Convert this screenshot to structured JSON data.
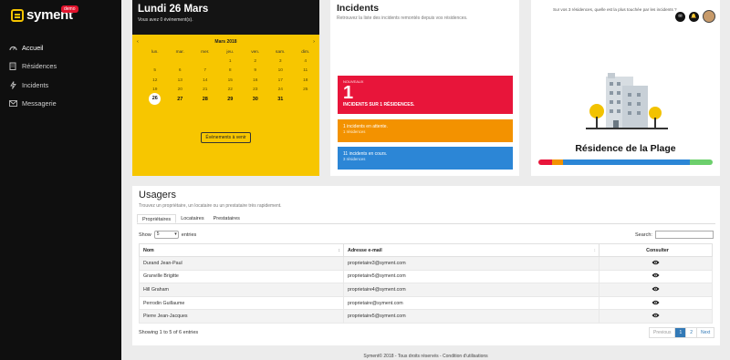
{
  "brand": {
    "name": "syment",
    "badge": "demo"
  },
  "nav": [
    {
      "label": "Accueil",
      "icon": "dashboard-icon"
    },
    {
      "label": "Résidences",
      "icon": "building-icon"
    },
    {
      "label": "Incidents",
      "icon": "bolt-icon"
    },
    {
      "label": "Messagerie",
      "icon": "envelope-icon"
    }
  ],
  "calendar": {
    "title": "Lundi 26 Mars",
    "subtitle": "Vous avez 0 évènement(s).",
    "month": "Mars 2018",
    "prev": "‹",
    "next": "›",
    "dow": [
      "lun.",
      "mar.",
      "mer.",
      "jeu.",
      "ven.",
      "sam.",
      "dim."
    ],
    "weeks": [
      [
        "",
        "",
        "",
        "1",
        "2",
        "3",
        "4"
      ],
      [
        "5",
        "6",
        "7",
        "8",
        "9",
        "10",
        "11"
      ],
      [
        "12",
        "13",
        "14",
        "15",
        "16",
        "17",
        "18"
      ],
      [
        "19",
        "20",
        "21",
        "22",
        "23",
        "24",
        "25"
      ],
      [
        "26",
        "27",
        "28",
        "29",
        "30",
        "31",
        ""
      ]
    ],
    "today": "26",
    "button": "Évènements à venir"
  },
  "incidents": {
    "title": "Incidents",
    "subtitle": "Retrouvez la liste des incidents remontés depuis vos résidences.",
    "new_label": "NOUVEAUX",
    "new_count": "1",
    "new_text": "INCIDENTS SUR 1 RÉSIDENCES.",
    "waiting_line1": "1 incidents en attente.",
    "waiting_line2": "1 résidences",
    "ongoing_line1": "11 incidents en cours.",
    "ongoing_line2": "3 résidences",
    "colors": {
      "new": "#e8153a",
      "waiting": "#f39200",
      "ongoing": "#2c86d6"
    }
  },
  "residence": {
    "question": "Sur vos 3 résidences, quelle est la plus touchée par les incidents ?",
    "name": "Résidence de la Plage",
    "bar": [
      {
        "color": "#e8153a",
        "share": 0.08
      },
      {
        "color": "#f39200",
        "share": 0.06
      },
      {
        "color": "#2c86d6",
        "share": 0.73
      },
      {
        "color": "#6ccf6c",
        "share": 0.13
      }
    ]
  },
  "usagers": {
    "title": "Usagers",
    "subtitle": "Trouvez un propriétaire, un locataire ou un prestataire très rapidement.",
    "tabs": [
      "Propriétaires",
      "Locataires",
      "Prestataires"
    ],
    "show_label": "Show",
    "show_value": "5",
    "entries_label": "entries",
    "search_label": "Search:",
    "columns": [
      "Nom",
      "Adresse e-mail",
      "Consulter"
    ],
    "rows": [
      [
        "Durand Jean-Paul",
        "proprietaire3@syment.com"
      ],
      [
        "Granville Brigitte",
        "proprietaire5@syment.com"
      ],
      [
        "Hill Graham",
        "proprietaire4@syment.com"
      ],
      [
        "Perrodin Guillaume",
        "proprietaire@syment.com"
      ],
      [
        "Pierre Jean-Jacques",
        "proprietaire5@syment.com"
      ]
    ],
    "info": "Showing 1 to 5 of 6 entries",
    "pager": [
      "Previous",
      "1",
      "2",
      "Next"
    ]
  },
  "footer": "Syment© 2018 - Tous droits réservés - Condition d'utilisations"
}
